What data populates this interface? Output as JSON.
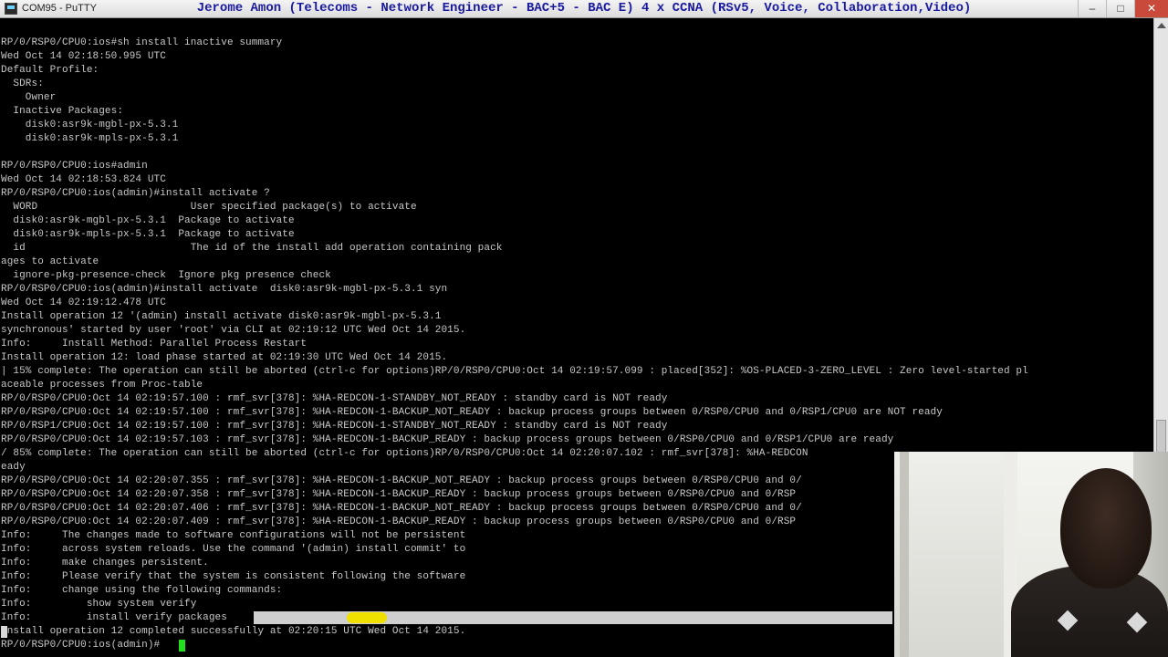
{
  "window": {
    "title": "COM95 - PuTTY",
    "overlay_title": "Jerome Amon (Telecoms - Network Engineer - BAC+5 - BAC E) 4 x CCNA (RSv5, Voice, Collaboration,Video)",
    "controls": {
      "minimize": "–",
      "maximize": "□",
      "close": "✕"
    }
  },
  "terminal": {
    "lines": [
      "RP/0/RSP0/CPU0:ios#sh install inactive summary",
      "Wed Oct 14 02:18:50.995 UTC",
      "Default Profile:",
      "  SDRs:",
      "    Owner",
      "  Inactive Packages:",
      "    disk0:asr9k-mgbl-px-5.3.1",
      "    disk0:asr9k-mpls-px-5.3.1",
      "",
      "RP/0/RSP0/CPU0:ios#admin",
      "Wed Oct 14 02:18:53.824 UTC",
      "RP/0/RSP0/CPU0:ios(admin)#install activate ?",
      "  WORD                         User specified package(s) to activate",
      "  disk0:asr9k-mgbl-px-5.3.1  Package to activate",
      "  disk0:asr9k-mpls-px-5.3.1  Package to activate",
      "  id                           The id of the install add operation containing pack",
      "ages to activate",
      "  ignore-pkg-presence-check  Ignore pkg presence check",
      "RP/0/RSP0/CPU0:ios(admin)#install activate  disk0:asr9k-mgbl-px-5.3.1 syn",
      "Wed Oct 14 02:19:12.478 UTC",
      "Install operation 12 '(admin) install activate disk0:asr9k-mgbl-px-5.3.1",
      "synchronous' started by user 'root' via CLI at 02:19:12 UTC Wed Oct 14 2015.",
      "Info:     Install Method: Parallel Process Restart",
      "Install operation 12: load phase started at 02:19:30 UTC Wed Oct 14 2015.",
      "| 15% complete: The operation can still be aborted (ctrl-c for options)RP/0/RSP0/CPU0:Oct 14 02:19:57.099 : placed[352]: %OS-PLACED-3-ZERO_LEVEL : Zero level-started pl",
      "aceable processes from Proc-table",
      "RP/0/RSP0/CPU0:Oct 14 02:19:57.100 : rmf_svr[378]: %HA-REDCON-1-STANDBY_NOT_READY : standby card is NOT ready",
      "RP/0/RSP0/CPU0:Oct 14 02:19:57.100 : rmf_svr[378]: %HA-REDCON-1-BACKUP_NOT_READY : backup process groups between 0/RSP0/CPU0 and 0/RSP1/CPU0 are NOT ready",
      "RP/0/RSP1/CPU0:Oct 14 02:19:57.100 : rmf_svr[378]: %HA-REDCON-1-STANDBY_NOT_READY : standby card is NOT ready",
      "RP/0/RSP0/CPU0:Oct 14 02:19:57.103 : rmf_svr[378]: %HA-REDCON-1-BACKUP_READY : backup process groups between 0/RSP0/CPU0 and 0/RSP1/CPU0 are ready",
      "/ 85% complete: The operation can still be aborted (ctrl-c for options)RP/0/RSP0/CPU0:Oct 14 02:20:07.102 : rmf_svr[378]: %HA-REDCON",
      "eady",
      "RP/0/RSP0/CPU0:Oct 14 02:20:07.355 : rmf_svr[378]: %HA-REDCON-1-BACKUP_NOT_READY : backup process groups between 0/RSP0/CPU0 and 0/",
      "RP/0/RSP0/CPU0:Oct 14 02:20:07.358 : rmf_svr[378]: %HA-REDCON-1-BACKUP_READY : backup process groups between 0/RSP0/CPU0 and 0/RSP",
      "RP/0/RSP0/CPU0:Oct 14 02:20:07.406 : rmf_svr[378]: %HA-REDCON-1-BACKUP_NOT_READY : backup process groups between 0/RSP0/CPU0 and 0/",
      "RP/0/RSP0/CPU0:Oct 14 02:20:07.409 : rmf_svr[378]: %HA-REDCON-1-BACKUP_READY : backup process groups between 0/RSP0/CPU0 and 0/RSP",
      "Info:     The changes made to software configurations will not be persistent",
      "Info:     across system reloads. Use the command '(admin) install commit' to",
      "Info:     make changes persistent.",
      "Info:     Please verify that the system is consistent following the software",
      "Info:     change using the following commands:",
      "Info:         show system verify",
      "Info:         install verify packages",
      "Install operation 12 completed successfully at 02:20:15 UTC Wed Oct 14 2015.",
      "RP/0/RSP0/CPU0:ios(admin)#"
    ]
  },
  "colors": {
    "terminal_bg": "#000000",
    "terminal_fg": "#c8c8c8",
    "cursor": "#23e01e",
    "overlay_title": "#1a1aa0"
  }
}
